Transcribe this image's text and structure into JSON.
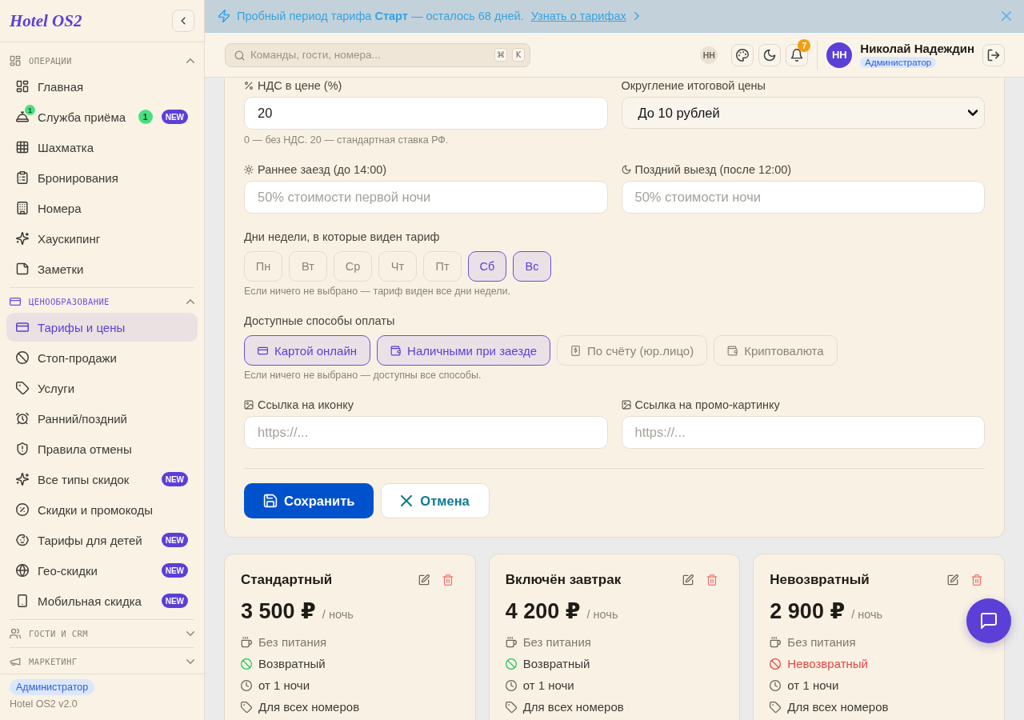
{
  "sidebar": {
    "logo": "Hotel OS2",
    "sections": [
      {
        "title": "ОПЕРАЦИИ",
        "active": false,
        "expanded": true,
        "items": [
          {
            "label": "Главная",
            "selected": false
          },
          {
            "label": "Служба приёма",
            "selected": false,
            "icon_badge": "1",
            "count": "1",
            "badge": "NEW"
          },
          {
            "label": "Шахматка",
            "selected": false
          },
          {
            "label": "Бронирования",
            "selected": false
          },
          {
            "label": "Номера",
            "selected": false
          },
          {
            "label": "Хаускипинг",
            "selected": false
          },
          {
            "label": "Заметки",
            "selected": false
          }
        ]
      },
      {
        "title": "ЦЕНООБРАЗОВАНИЕ",
        "active": true,
        "expanded": true,
        "items": [
          {
            "label": "Тарифы и цены",
            "selected": true
          },
          {
            "label": "Стоп-продажи",
            "selected": false
          },
          {
            "label": "Услуги",
            "selected": false
          },
          {
            "label": "Ранний/поздний",
            "selected": false
          },
          {
            "label": "Правила отмены",
            "selected": false
          },
          {
            "label": "Все типы скидок",
            "selected": false,
            "badge": "NEW"
          },
          {
            "label": "Скидки и промокоды",
            "selected": false
          },
          {
            "label": "Тарифы для детей",
            "selected": false,
            "badge": "NEW"
          },
          {
            "label": "Гео-скидки",
            "selected": false,
            "badge": "NEW"
          },
          {
            "label": "Мобильная скидка",
            "selected": false,
            "badge": "NEW"
          }
        ]
      },
      {
        "title": "ГОСТИ И CRM",
        "active": false,
        "expanded": false
      },
      {
        "title": "МАРКЕТИНГ",
        "active": false,
        "expanded": false
      }
    ],
    "footer": {
      "role": "Администратор",
      "version": "Hotel OS2 v2.0"
    }
  },
  "banner": {
    "text": "Пробный период тарифа **Старт** — осталось 68 дней.",
    "link": "Узнать о тарифах"
  },
  "header": {
    "search": {
      "placeholder": "Команды, гости, номера...",
      "keys": [
        "⌘",
        "K"
      ]
    },
    "presence": "НН",
    "notifications": "7",
    "user": {
      "initials": "НН",
      "name": "Николай Надеждин",
      "role": "Администратор"
    }
  },
  "form": {
    "vat": {
      "label": "НДС в цене (%)",
      "value": "20",
      "hint": "0 — без НДС. 20 — стандартная ставка РФ."
    },
    "rounding": {
      "label": "Округление итоговой цены",
      "value": "До 10 рублей"
    },
    "early_checkin": {
      "label": "Раннее заезд (до 14:00)",
      "placeholder": "50% стоимости первой ночи"
    },
    "late_checkout": {
      "label": "Поздний выезд (после 12:00)",
      "placeholder": "50% стоимости ночи"
    },
    "weekdays": {
      "label": "Дни недели, в которые виден тариф",
      "days": [
        {
          "label": "Пн",
          "selected": false
        },
        {
          "label": "Вт",
          "selected": false
        },
        {
          "label": "Ср",
          "selected": false
        },
        {
          "label": "Чт",
          "selected": false
        },
        {
          "label": "Пт",
          "selected": false
        },
        {
          "label": "Сб",
          "selected": true
        },
        {
          "label": "Вс",
          "selected": true
        }
      ],
      "hint": "Если ничего не выбрано — тариф виден все дни недели."
    },
    "payment_methods": {
      "label": "Доступные способы оплаты",
      "options": [
        {
          "label": "Картой онлайн",
          "selected": true
        },
        {
          "label": "Наличными при заезде",
          "selected": true
        },
        {
          "label": "По счёту (юр.лицо)",
          "selected": false
        },
        {
          "label": "Криптовалюта",
          "selected": false
        }
      ],
      "hint": "Если ничего не выбрано — доступны все способы."
    },
    "icon_url": {
      "label": "Ссылка на иконку",
      "placeholder": "https://..."
    },
    "promo_url": {
      "label": "Ссылка на промо-картинку",
      "placeholder": "https://..."
    },
    "save_button": "Сохранить",
    "cancel_button": "Отмена"
  },
  "rates": [
    {
      "name": "Стандартный",
      "price": "3 500 ₽",
      "unit": "/ ночь",
      "features": [
        {
          "kind": "meal",
          "text": "Без питания"
        },
        {
          "kind": "refund",
          "text": "Возвратный",
          "refundable": true
        },
        {
          "kind": "stay",
          "text": "от 1 ночи"
        },
        {
          "kind": "rooms",
          "text": "Для всех номеров"
        }
      ]
    },
    {
      "name": "Включён завтрак",
      "price": "4 200 ₽",
      "unit": "/ ночь",
      "features": [
        {
          "kind": "meal",
          "text": "Без питания"
        },
        {
          "kind": "refund",
          "text": "Возвратный",
          "refundable": true
        },
        {
          "kind": "stay",
          "text": "от 1 ночи"
        },
        {
          "kind": "rooms",
          "text": "Для всех номеров"
        }
      ]
    },
    {
      "name": "Невозвратный",
      "price": "2 900 ₽",
      "unit": "/ ночь",
      "features": [
        {
          "kind": "meal",
          "text": "Без питания"
        },
        {
          "kind": "refund",
          "text": "Невозвратный",
          "refundable": false
        },
        {
          "kind": "stay",
          "text": "от 1 ночи"
        },
        {
          "kind": "rooms",
          "text": "Для всех номеров"
        }
      ]
    }
  ]
}
